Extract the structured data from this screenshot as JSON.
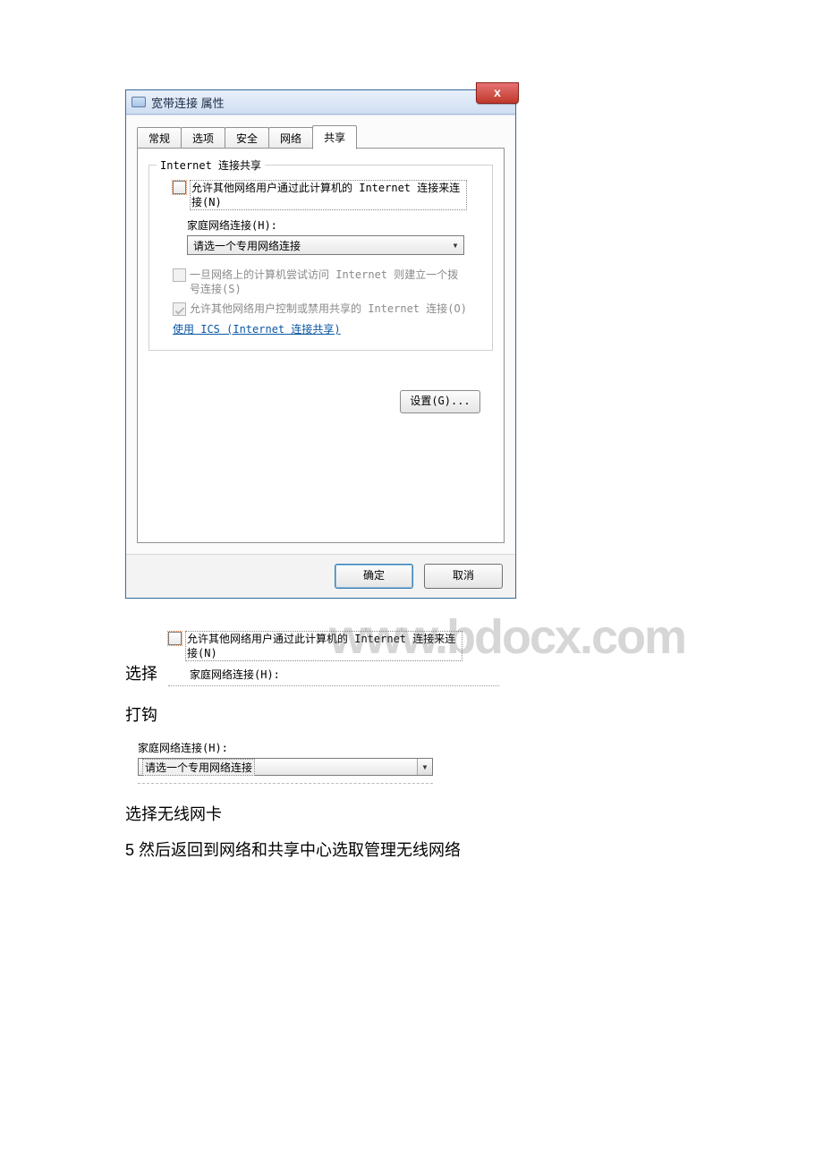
{
  "dialog": {
    "title": "宽带连接 属性",
    "close_glyph": "x",
    "tabs": {
      "general": "常规",
      "options": "选项",
      "security": "安全",
      "network": "网络",
      "sharing": "共享"
    },
    "group": {
      "legend": "Internet 连接共享",
      "allow_label": "允许其他网络用户通过此计算机的 Internet 连接来连接(N)",
      "home_net_label": "家庭网络连接(H):",
      "dropdown_value": "请选一个专用网络连接",
      "dial_label": "一旦网络上的计算机尝试访问 Internet 则建立一个拨号连接(S)",
      "control_label": "允许其他网络用户控制或禁用共享的 Internet 连接(O)",
      "ics_link": "使用 ICS (Internet 连接共享)",
      "settings_btn": "设置(G)..."
    },
    "ok": "确定",
    "cancel": "取消"
  },
  "snippet1": {
    "allow_label": "允许其他网络用户通过此计算机的 Internet 连接来连接(N)",
    "home_cut": "家庭网络连接(H):"
  },
  "watermark": "www.bdocx.com",
  "text": {
    "select": "选择",
    "check": "打钩",
    "select_wlan": "选择无线网卡",
    "step5": "5 然后返回到网络和共享中心选取管理无线网络"
  },
  "snippet2": {
    "label": "家庭网络连接(H):",
    "value": "请选一个专用网络连接"
  }
}
